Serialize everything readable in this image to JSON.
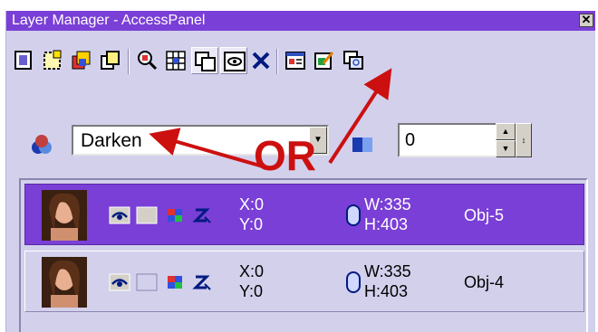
{
  "window": {
    "title": "Layer Manager - AccessPanel",
    "close_glyph": "✕"
  },
  "colors": {
    "accent": "#7a3fd6",
    "panel": "#d3d0ec",
    "annotation": "#cc1010"
  },
  "toolbar": {
    "icons": [
      "new-layer-icon",
      "new-layer-dashed-icon",
      "layer-stack-color-icon",
      "layer-copy-icon",
      "zoom-find-icon",
      "grid-select-icon",
      "overlap-icon",
      "view-frame-icon",
      "delete-x-icon",
      "properties-icon",
      "edit-icon",
      "multi-window-icon"
    ],
    "delete_glyph": "✕"
  },
  "blend": {
    "value": "Darken",
    "dropdown_glyph": "▼"
  },
  "opacity": {
    "value": "0",
    "up_glyph": "▲",
    "down_glyph": "▼",
    "extra_glyph": "↕"
  },
  "layers": [
    {
      "name": "Obj-5",
      "x": "X:0",
      "y": "Y:0",
      "w": "W:335",
      "h": "H:403",
      "selected": true
    },
    {
      "name": "Obj-4",
      "x": "X:0",
      "y": "Y:0",
      "w": "W:335",
      "h": "H:403",
      "selected": false
    }
  ],
  "annotation": {
    "label": "OR"
  }
}
